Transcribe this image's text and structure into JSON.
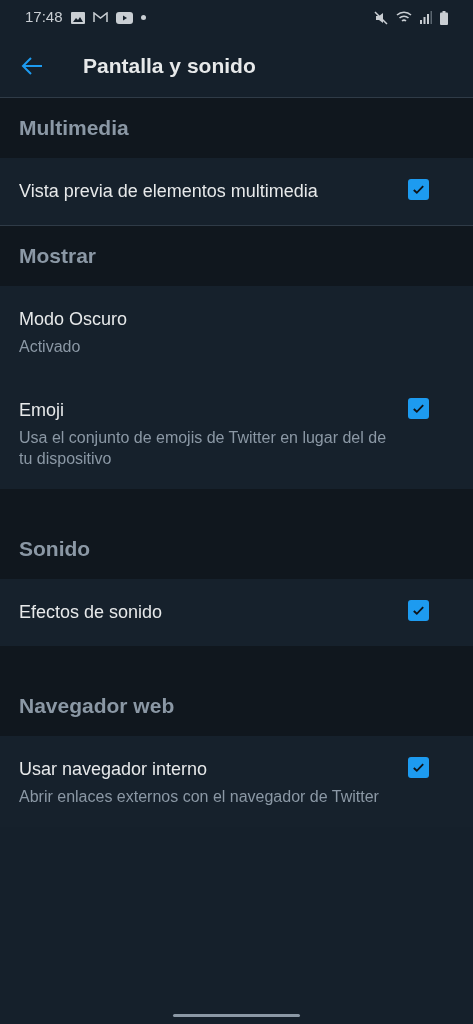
{
  "status_bar": {
    "time": "17:48"
  },
  "header": {
    "title": "Pantalla y sonido"
  },
  "sections": [
    {
      "title": "Multimedia",
      "divider": true,
      "items": [
        {
          "title": "Vista previa de elementos multimedia",
          "checkbox": true,
          "checked": true
        }
      ]
    },
    {
      "title": "Mostrar",
      "divider": false,
      "items": [
        {
          "title": "Modo Oscuro",
          "subtitle": "Activado",
          "checkbox": false
        },
        {
          "title": "Emoji",
          "subtitle": "Usa el conjunto de emojis de Twitter en lugar del de tu dispositivo",
          "checkbox": true,
          "checked": true
        }
      ]
    },
    {
      "title": "Sonido",
      "divider": false,
      "items": [
        {
          "title": "Efectos de sonido",
          "checkbox": true,
          "checked": true
        }
      ]
    },
    {
      "title": "Navegador web",
      "divider": false,
      "items": [
        {
          "title": "Usar navegador interno",
          "subtitle": "Abrir enlaces externos con el navegador de Twitter",
          "checkbox": true,
          "checked": true
        }
      ]
    }
  ]
}
